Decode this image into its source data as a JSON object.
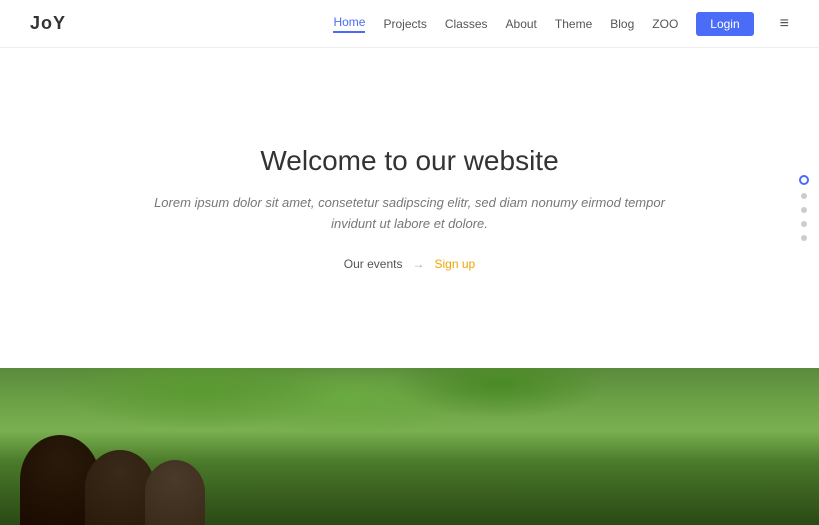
{
  "brand": {
    "name": "JoY"
  },
  "navbar": {
    "links": [
      {
        "label": "Home",
        "active": true
      },
      {
        "label": "Projects",
        "active": false
      },
      {
        "label": "Classes",
        "active": false
      },
      {
        "label": "About",
        "active": false
      },
      {
        "label": "Theme",
        "active": false
      },
      {
        "label": "Blog",
        "active": false
      },
      {
        "label": "ZOO",
        "active": false
      }
    ],
    "login_label": "Login",
    "menu_icon": "≡"
  },
  "hero": {
    "title": "Welcome to our website",
    "subtitle": "Lorem ipsum dolor sit amet, consetetur sadipscing elitr, sed diam nonumy eirmod tempor invidunt ut labore et dolore.",
    "link_events": "Our events",
    "link_separator": "→",
    "link_signup": "Sign up"
  },
  "side_nav": {
    "dots": [
      {
        "active": true
      },
      {
        "active": false
      },
      {
        "active": false
      },
      {
        "active": false
      },
      {
        "active": false
      }
    ]
  },
  "colors": {
    "accent": "#4a6cf7",
    "signup": "#f0a500"
  }
}
